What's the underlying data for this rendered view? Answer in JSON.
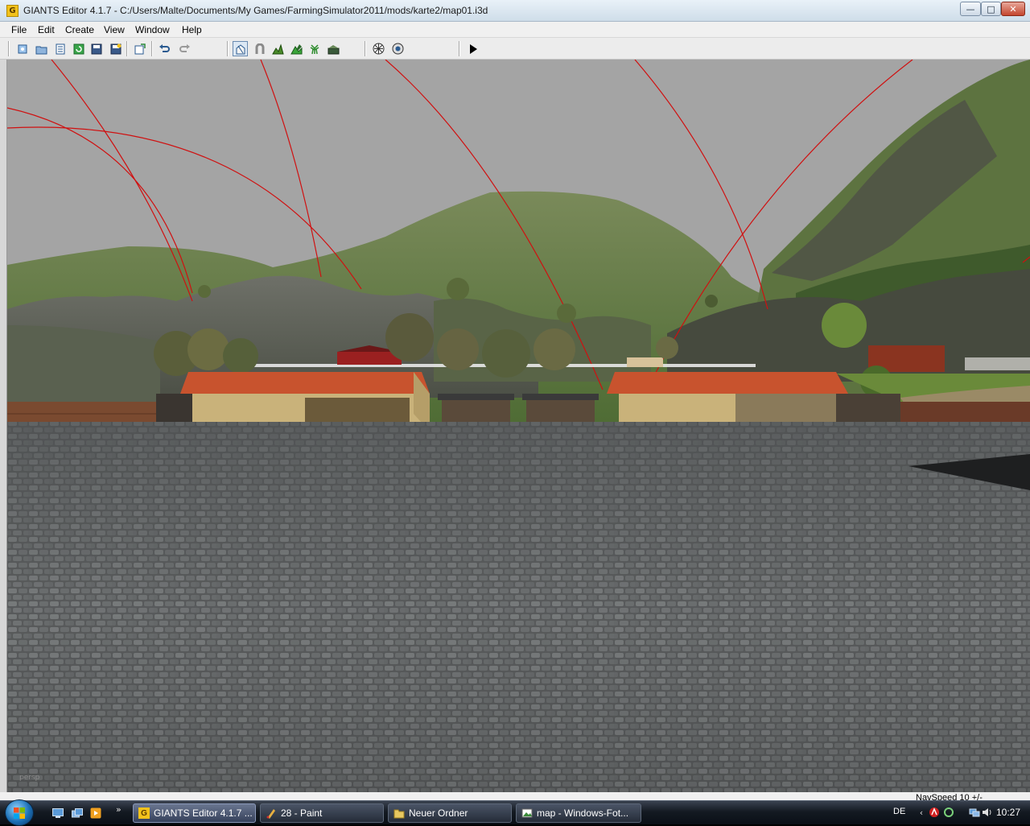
{
  "window": {
    "title": "GIANTS Editor 4.1.7 - C:/Users/Malte/Documents/My Games/FarmingSimulator2011/mods/karte2/map01.i3d",
    "icon_letter": "G",
    "controls": {
      "minimize": "—",
      "maximize": "□",
      "close": "✕"
    }
  },
  "menu": {
    "items": [
      {
        "label": "File"
      },
      {
        "label": "Edit"
      },
      {
        "label": "Create"
      },
      {
        "label": "View"
      },
      {
        "label": "Window"
      },
      {
        "label": "Help"
      }
    ]
  },
  "toolbar": {
    "icons": {
      "new": "new-scene-icon",
      "open": "open-icon",
      "properties": "properties-icon",
      "reload": "reload-icon",
      "save": "save-icon",
      "save_as": "save-as-icon",
      "import": "import-icon",
      "undo": "undo-icon",
      "redo": "redo-icon",
      "select": "select-mode-icon",
      "move": "magnet-icon",
      "terrain": "terrain-sculpt-icon",
      "paint": "terrain-paint-icon",
      "foliage": "foliage-paint-icon",
      "objects": "object-paint-icon",
      "texture": "texture-icon",
      "shader": "shader-icon",
      "play": "play-icon"
    }
  },
  "viewport": {
    "camera_label": "persp"
  },
  "statusbar": {
    "navspeed": "NavSpeed 10 +/-"
  },
  "taskbar": {
    "tasks": [
      {
        "label": "GIANTS Editor 4.1.7 ...",
        "icon": "giants-editor-icon"
      },
      {
        "label": "28 - Paint",
        "icon": "paint-icon"
      },
      {
        "label": "Neuer Ordner",
        "icon": "folder-icon"
      },
      {
        "label": "map - Windows-Fot...",
        "icon": "photo-viewer-icon"
      }
    ],
    "more": "»",
    "tray": {
      "language": "DE",
      "clock": "10:27"
    }
  },
  "colors": {
    "sky": "#a4a4a4",
    "powerline": "#d01010",
    "roof": "#c8532e",
    "wall": "#c9b27a",
    "ground": "#5b5e5f"
  }
}
